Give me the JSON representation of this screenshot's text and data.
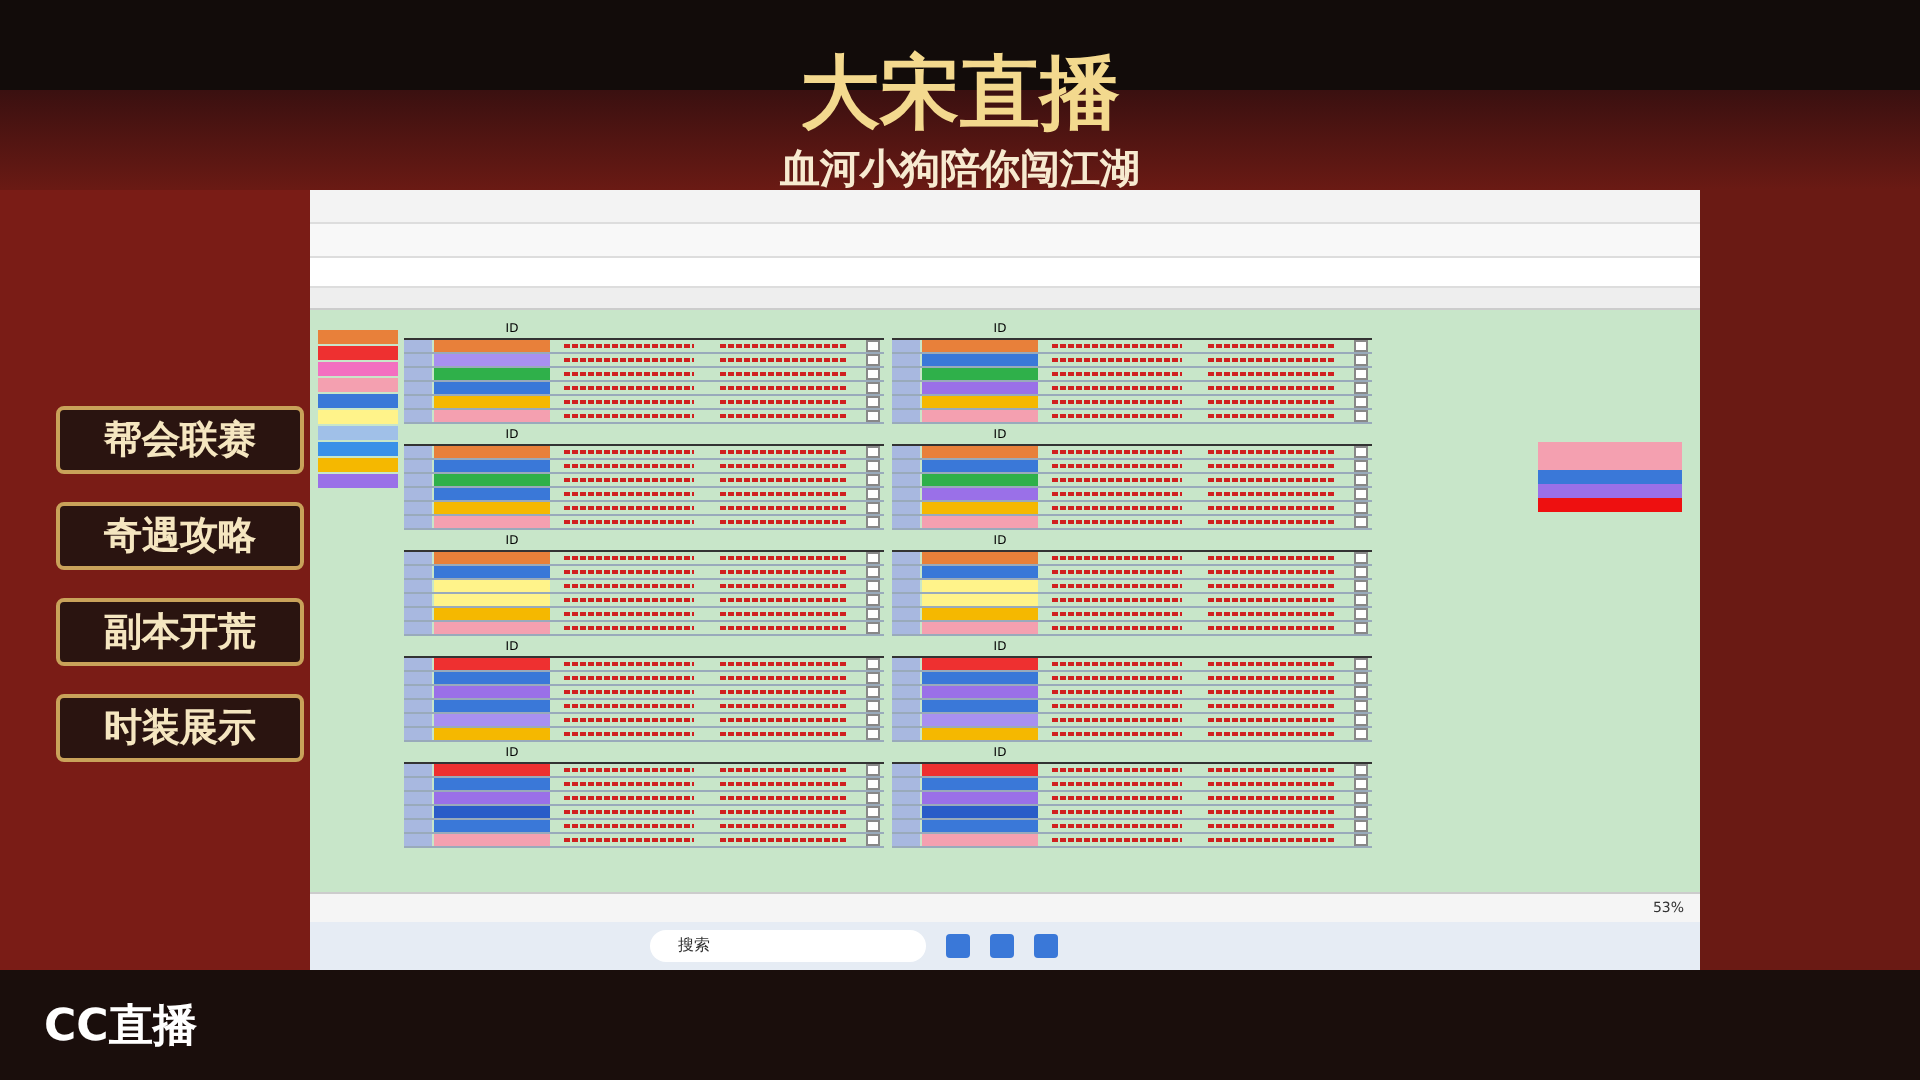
{
  "stream": {
    "title": "大宋直播",
    "subtitle": "血河小狗陪你闯江湖",
    "logo": "CC直播"
  },
  "menu": [
    {
      "label": "帮会联赛"
    },
    {
      "label": "奇遇攻略"
    },
    {
      "label": "副本开荒"
    },
    {
      "label": "时装展示"
    }
  ],
  "sheet": {
    "legend": [
      {
        "color": "#e8803a"
      },
      {
        "color": "#ee3030"
      },
      {
        "color": "#f36fc0"
      },
      {
        "color": "#f4a0b0"
      },
      {
        "color": "#3a78d8"
      },
      {
        "color": "#fff38a"
      },
      {
        "color": "#a0c0e8"
      },
      {
        "color": "#3a90e8"
      },
      {
        "color": "#f5b800"
      },
      {
        "color": "#9a70e8"
      }
    ],
    "blocks": [
      {
        "header": "ID",
        "rows": [
          {
            "color": "#e8803a",
            "checked": false
          },
          {
            "color": "#a890f0",
            "checked": false
          },
          {
            "color": "#2fb04a",
            "checked": false
          },
          {
            "color": "#3a78d8",
            "checked": false
          },
          {
            "color": "#f5b800",
            "checked": false
          },
          {
            "color": "#f4a0b0",
            "checked": false
          }
        ]
      },
      {
        "header": "ID",
        "rows": [
          {
            "color": "#e8803a",
            "checked": false
          },
          {
            "color": "#3a78d8",
            "checked": false
          },
          {
            "color": "#2fb04a",
            "checked": false
          },
          {
            "color": "#9a70e8",
            "checked": false
          },
          {
            "color": "#f5b800",
            "checked": false
          },
          {
            "color": "#f4a0b0",
            "checked": false
          }
        ]
      },
      {
        "header": "ID",
        "rows": [
          {
            "color": "#e8803a",
            "checked": false
          },
          {
            "color": "#3a78d8",
            "checked": false
          },
          {
            "color": "#2fb04a",
            "checked": false
          },
          {
            "color": "#3a78d8",
            "checked": false
          },
          {
            "color": "#f5b800",
            "checked": false
          },
          {
            "color": "#f4a0b0",
            "checked": false
          }
        ]
      },
      {
        "header": "ID",
        "rows": [
          {
            "color": "#e8803a",
            "checked": false
          },
          {
            "color": "#3a78d8",
            "checked": false
          },
          {
            "color": "#2fb04a",
            "checked": false
          },
          {
            "color": "#9a70e8",
            "checked": false
          },
          {
            "color": "#f5b800",
            "checked": false
          },
          {
            "color": "#f4a0b0",
            "checked": false
          }
        ]
      },
      {
        "header": "ID",
        "rows": [
          {
            "color": "#e8803a",
            "checked": false
          },
          {
            "color": "#3a78d8",
            "checked": false
          },
          {
            "color": "#fff38a",
            "checked": false
          },
          {
            "color": "#fff38a",
            "checked": false
          },
          {
            "color": "#f5b800",
            "checked": false
          },
          {
            "color": "#f4a0b0",
            "checked": false
          }
        ]
      },
      {
        "header": "ID",
        "rows": [
          {
            "color": "#e8803a",
            "checked": false
          },
          {
            "color": "#3a78d8",
            "checked": false
          },
          {
            "color": "#fff38a",
            "checked": false
          },
          {
            "color": "#fff38a",
            "checked": false
          },
          {
            "color": "#f5b800",
            "checked": false
          },
          {
            "color": "#f4a0b0",
            "checked": false
          }
        ]
      },
      {
        "header": "ID",
        "rows": [
          {
            "color": "#ee3030",
            "checked": false
          },
          {
            "color": "#3a78d8",
            "checked": false
          },
          {
            "color": "#9a70e8",
            "checked": false
          },
          {
            "color": "#3a78d8",
            "checked": false
          },
          {
            "color": "#a890f0",
            "checked": false
          },
          {
            "color": "#f5b800",
            "checked": false
          }
        ]
      },
      {
        "header": "ID",
        "rows": [
          {
            "color": "#ee3030",
            "checked": false
          },
          {
            "color": "#3a78d8",
            "checked": false
          },
          {
            "color": "#9a70e8",
            "checked": false
          },
          {
            "color": "#3a78d8",
            "checked": false
          },
          {
            "color": "#a890f0",
            "checked": false
          },
          {
            "color": "#f5b800",
            "checked": false
          }
        ]
      },
      {
        "header": "ID",
        "rows": [
          {
            "color": "#ee3030",
            "checked": false
          },
          {
            "color": "#3a78d8",
            "checked": false
          },
          {
            "color": "#9a70e8",
            "checked": false
          },
          {
            "color": "#2a5cc8",
            "checked": false
          },
          {
            "color": "#3a78d8",
            "checked": false
          },
          {
            "color": "#f4a0b0",
            "checked": false
          }
        ]
      },
      {
        "header": "ID",
        "rows": [
          {
            "color": "#ee3030",
            "checked": false
          },
          {
            "color": "#3a78d8",
            "checked": false
          },
          {
            "color": "#9a70e8",
            "checked": false
          },
          {
            "color": "#2a5cc8",
            "checked": false
          },
          {
            "color": "#3a78d8",
            "checked": false
          },
          {
            "color": "#f4a0b0",
            "checked": false
          }
        ]
      }
    ],
    "side_swatches": [
      {
        "color": "#f4a0b0"
      },
      {
        "color": "#f4a0b0"
      },
      {
        "color": "#3a78d8"
      },
      {
        "color": "#9a70e8"
      },
      {
        "color": "#ee1010"
      }
    ]
  },
  "taskbar": {
    "search": "搜索",
    "zoom": "53%"
  }
}
